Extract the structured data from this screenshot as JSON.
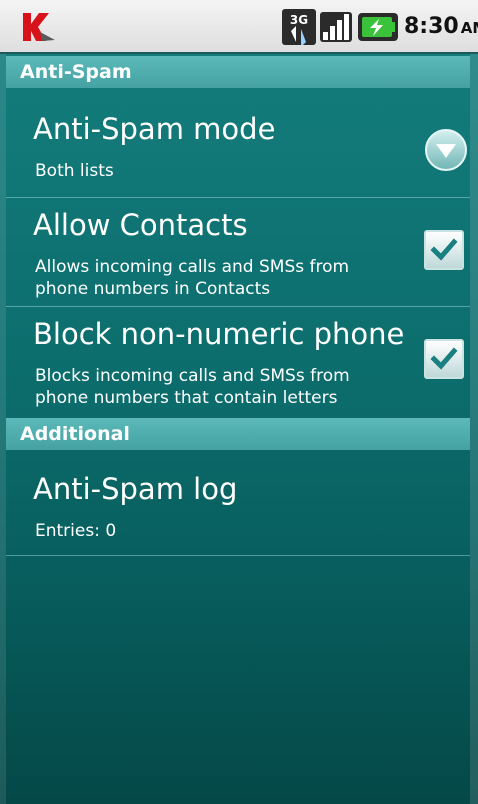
{
  "status_bar": {
    "network_type": "3G",
    "time": "8:30",
    "am_pm": "AM",
    "icons": [
      "kaspersky-logo-icon",
      "3g-data-icon",
      "signal-strength-icon",
      "battery-charging-icon"
    ]
  },
  "colors": {
    "background": "#0c6c6c",
    "section_header": "#4faeae",
    "checkbox_check": "#1a7f80"
  },
  "sections": [
    {
      "header": "Anti-Spam",
      "items": [
        {
          "title": "Anti-Spam mode",
          "summary": "Both lists",
          "control": "dropdown"
        },
        {
          "title": "Allow Contacts",
          "summary": "Allows incoming calls and SMSs from phone numbers in Contacts",
          "control": "checkbox",
          "checked": true
        },
        {
          "title": "Block non-numeric phone",
          "summary": "Blocks incoming calls and SMSs from phone numbers that contain letters",
          "control": "checkbox",
          "checked": true
        }
      ]
    },
    {
      "header": "Additional",
      "items": [
        {
          "title": "Anti-Spam log",
          "summary": "Entries: 0",
          "control": "none"
        }
      ]
    }
  ]
}
